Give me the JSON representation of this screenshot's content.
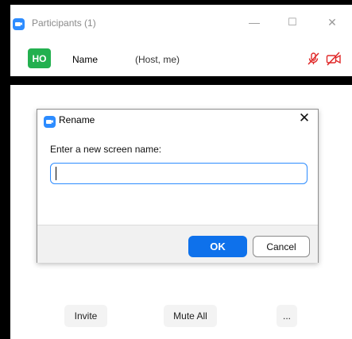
{
  "participants_window": {
    "title": "Participants (1)",
    "controls": {
      "minimize": "—",
      "maximize": "☐",
      "close": "✕"
    },
    "participant": {
      "initials": "HO",
      "name": "Name",
      "role": "(Host, me)",
      "avatar_color": "#23b04f",
      "mic_icon": "mic-muted-icon",
      "video_icon": "video-off-icon",
      "status_color": "#e02828"
    },
    "footer": {
      "invite": "Invite",
      "mute_all": "Mute All",
      "more": "..."
    }
  },
  "rename_dialog": {
    "title": "Rename",
    "close": "✕",
    "prompt": "Enter a new screen name:",
    "input_value": "",
    "ok": "OK",
    "cancel": "Cancel",
    "accent": "#0e71eb"
  }
}
